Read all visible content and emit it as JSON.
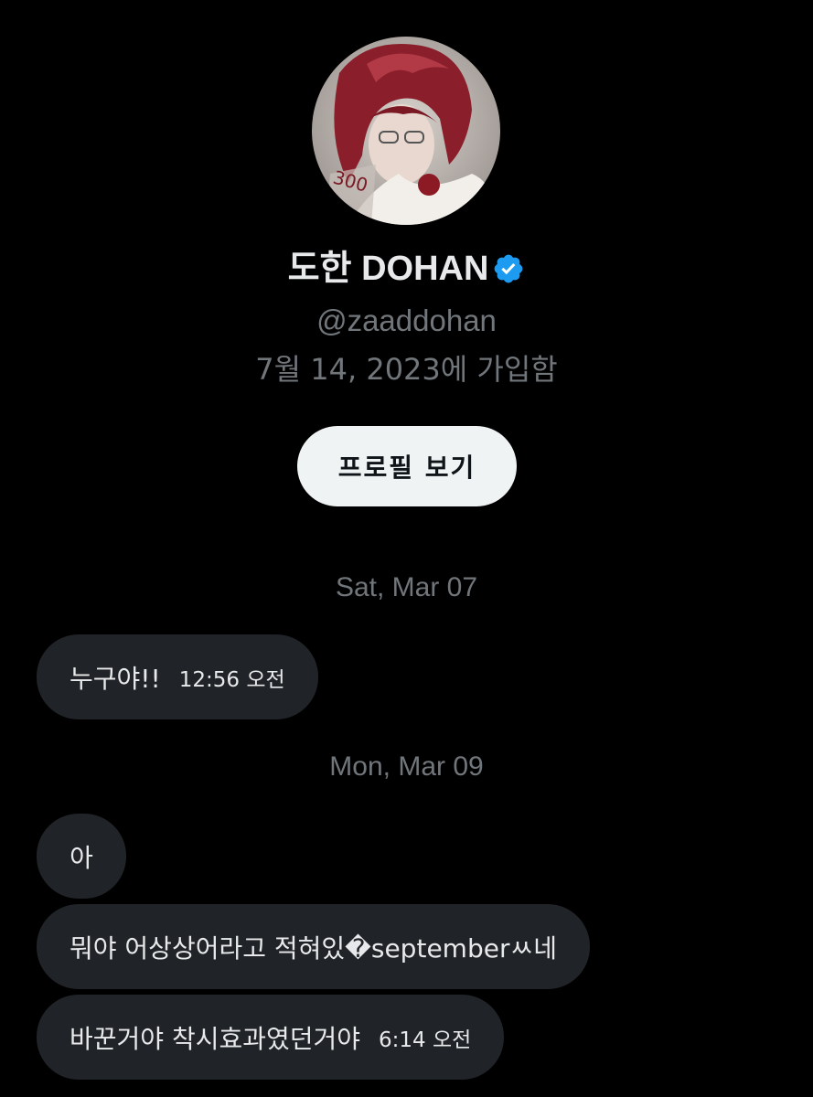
{
  "profile": {
    "display_name": "도한 DOHAN",
    "handle": "@zaaddohan",
    "joined": "7월 14, 2023에 가입함",
    "view_profile_label": "프로필 보기",
    "verified_color": "#1d9bf0"
  },
  "conversation": [
    {
      "date": "Sat, Mar 07",
      "messages": [
        {
          "text": "누구야!!",
          "time": "12:56 오전"
        }
      ]
    },
    {
      "date": "Mon, Mar 09",
      "messages": [
        {
          "text": "아",
          "time": ""
        },
        {
          "text": "뭐야 어상상어라고 적혀있�septemberㅆ네",
          "time": ""
        },
        {
          "text": "바꾼거야 착시효과였던거야",
          "time": "6:14 오전"
        }
      ]
    }
  ],
  "colors": {
    "background": "#000000",
    "bubble": "#202327",
    "muted_text": "#71767b",
    "primary_text": "#e7e9ea",
    "button_bg": "#eff3f4"
  }
}
